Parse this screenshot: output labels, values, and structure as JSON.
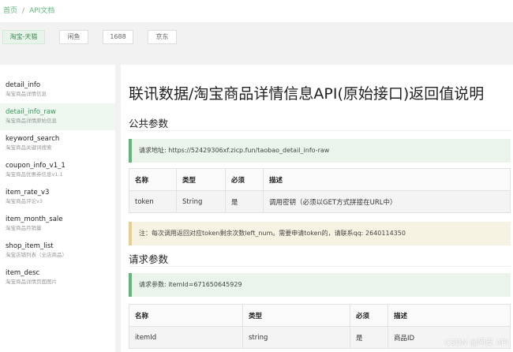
{
  "breadcrumb": {
    "home": "首页",
    "separator": "/",
    "current": "API文档"
  },
  "platforms": [
    "淘宝-天猫",
    "闲鱼",
    "1688",
    "京东"
  ],
  "sidebar": {
    "items": [
      {
        "title": "detail_info",
        "subtitle": "淘宝商品详情信息"
      },
      {
        "title": "detail_info_raw",
        "subtitle": "淘宝商品详情原始信息"
      },
      {
        "title": "keyword_search",
        "subtitle": "淘宝商品关键词搜索"
      },
      {
        "title": "coupon_info_v1_1",
        "subtitle": "淘宝商品优惠券信息v1.1"
      },
      {
        "title": "item_rate_v3",
        "subtitle": "淘宝商品评论v3"
      },
      {
        "title": "item_month_sale",
        "subtitle": "淘宝商品月销量"
      },
      {
        "title": "shop_item_list",
        "subtitle": "淘宝店铺列表（全店商品）"
      },
      {
        "title": "item_desc",
        "subtitle": "淘宝商品详情页面图片"
      }
    ]
  },
  "main": {
    "title": "联讯数据/淘宝商品详情信息API(原始接口)返回值说明",
    "public_params": {
      "heading": "公共参数",
      "request_url": "请求地址: https://52429306xf.zicp.fun/taobao_detail_info-raw",
      "columns": [
        "名称",
        "类型",
        "必须",
        "描述"
      ],
      "rows": [
        [
          "token",
          "String",
          "是",
          "调用密钥（必须以GET方式拼接在URL中）"
        ]
      ],
      "note": "注：每次调用返回对应token剩余次数left_num。需要申请token的，请联系qq: 2640114350"
    },
    "request_params": {
      "heading": "请求参数",
      "example": "请求参数: itemId=671650645929",
      "columns": [
        "名称",
        "类型",
        "必须",
        "描述"
      ],
      "rows": [
        [
          "itemId",
          "string",
          "是",
          "商品ID"
        ]
      ]
    }
  },
  "watermark": "CSDN @阿皮 API"
}
